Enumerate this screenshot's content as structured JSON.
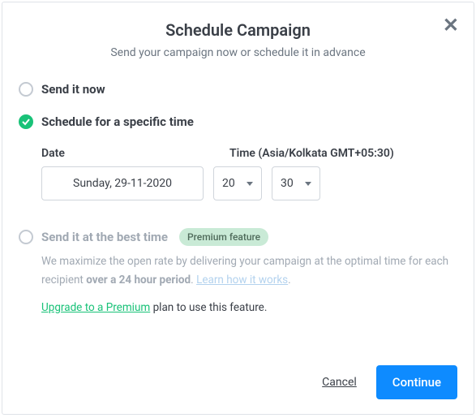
{
  "header": {
    "title": "Schedule Campaign",
    "subtitle": "Send your campaign now or schedule it in advance"
  },
  "options": {
    "now": {
      "label": "Send it now"
    },
    "specific": {
      "label": "Schedule for a specific time",
      "date_label": "Date",
      "time_label": "Time (Asia/Kolkata GMT+05:30)",
      "date_value": "Sunday, 29-11-2020",
      "hour": "20",
      "minute": "30"
    },
    "best": {
      "label": "Send it at the best time",
      "badge": "Premium feature",
      "desc_prefix": "We maximize the open rate by delivering your campaign at the optimal time for each recipient ",
      "desc_bold": "over a 24 hour period",
      "desc_sep": ". ",
      "learn_link": "Learn how it works",
      "desc_suffix": ".",
      "upgrade_link": "Upgrade to a Premium",
      "upgrade_suffix": " plan to use this feature."
    }
  },
  "footer": {
    "cancel": "Cancel",
    "continue": "Continue"
  }
}
